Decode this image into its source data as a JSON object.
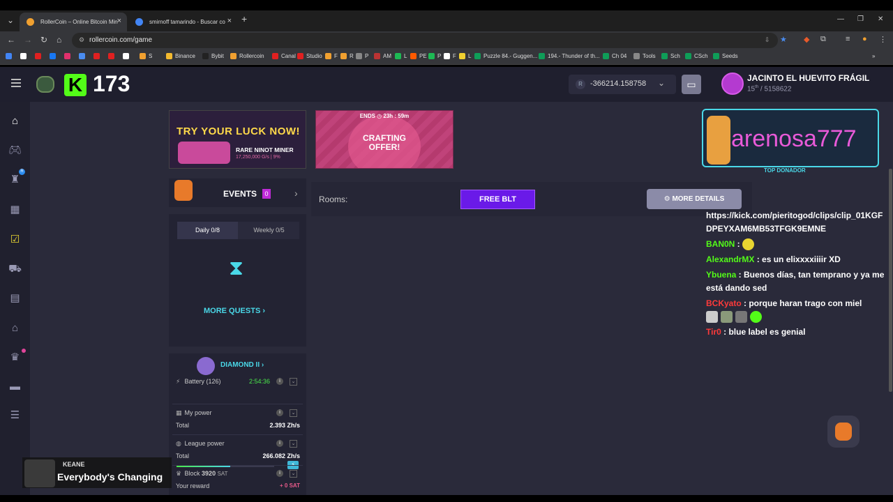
{
  "browser": {
    "tabs": [
      {
        "title": "RollerCoin – Online Bitcoin Min",
        "active": true,
        "color": "#f0a030"
      },
      {
        "title": "smirnoff tamarindo - Buscar co",
        "active": false,
        "color": "#4285f4"
      }
    ],
    "url": "rollercoin.com/game",
    "bookmarks": [
      {
        "label": "S",
        "color": "#f0a030"
      },
      {
        "label": "Binance",
        "color": "#f3ba2f"
      },
      {
        "label": "Bybit",
        "color": "#222"
      },
      {
        "label": "Rollercoin",
        "color": "#f0a030"
      },
      {
        "label": "Canal",
        "color": "#e02020"
      },
      {
        "label": "Studio",
        "color": "#e02020"
      },
      {
        "label": "F",
        "color": "#f0a030"
      },
      {
        "label": "R",
        "color": "#f0a030"
      },
      {
        "label": "P",
        "color": "#888"
      },
      {
        "label": "AM",
        "color": "#b33"
      },
      {
        "label": "L",
        "color": "#1db954"
      },
      {
        "label": "PE",
        "color": "#ff5a00"
      },
      {
        "label": "P",
        "color": "#1db954"
      },
      {
        "label": "F",
        "color": "#fff"
      },
      {
        "label": "L",
        "color": "#f0d030"
      },
      {
        "label": "Puzzle 84.- Guggen...",
        "color": "#0f9d58"
      },
      {
        "label": "194.- Thunder of th...",
        "color": "#0f9d58"
      },
      {
        "label": "Ch 04",
        "color": "#0f9d58"
      },
      {
        "label": "Tools",
        "color": "#888"
      },
      {
        "label": "Sch",
        "color": "#0f9d58"
      },
      {
        "label": "CSch",
        "color": "#0f9d58"
      },
      {
        "label": "Seeds",
        "color": "#0f9d58"
      }
    ]
  },
  "topbar": {
    "kick_count": "173",
    "balance": "-366214.158758",
    "balance_icon": "R",
    "user_name": "JACINTO EL HUEVITO FRÁGIL",
    "user_rank": "15",
    "user_rank_suffix": "th",
    "user_total": "/ 5158622"
  },
  "banners": {
    "luck_title": "TRY YOUR LUCK NOW!",
    "luck_sub": "RARE NINOT MINER",
    "luck_detail": "17,250,000 G/s | 9%",
    "ends_label": "ENDS",
    "ends_time": "23h : 59m",
    "crafting": "CRAFTING OFFER!"
  },
  "events": {
    "label": "EVENTS",
    "count": "0"
  },
  "quests": {
    "daily": "Daily 0/8",
    "weekly": "Weekly 0/5",
    "more": "MORE QUESTS"
  },
  "mining": {
    "league": "DIAMOND II",
    "battery_label": "Battery (126)",
    "battery_time": "2:54:36",
    "battery_level": 0.55,
    "my_power": "My power",
    "total_label": "Total",
    "my_total": "2.393 Zh/s",
    "league_power": "League power",
    "league_total": "266.082 Zh/s",
    "block_label": "Block",
    "block_value": "3920",
    "block_unit": "SAT",
    "reward_label": "Your reward",
    "reward_value": "+ 0 SAT"
  },
  "rooms": {
    "label": "Rooms:",
    "free_blt": "FREE BLT",
    "more_details": "MORE DETAILS"
  },
  "overlay": {
    "donor_name": "arenosa777",
    "donor_label": "TOP DONADOR",
    "chat": [
      {
        "user": "BANON",
        "text": "",
        "color": "#fff"
      },
      {
        "user": "",
        "text": "https://kick.com/pieritogod/clips/clip_01KGFDPEYXAM6MB53TFGK9EMNE",
        "color": "#fff"
      },
      {
        "user": "BAN0N",
        "text": " : ",
        "color": "#53fc18"
      },
      {
        "user": "AlexandrMX",
        "text": " : es un elixxxxiiiir XD",
        "color": "#53fc18"
      },
      {
        "user": "Ybuena",
        "text": " : Buenos días, tan temprano y ya me está dando sed",
        "color": "#53fc18"
      },
      {
        "user": "BCKyato",
        "text": " : porque haran trago con miel",
        "color": "#ff3a3a"
      },
      {
        "user": "Tir0",
        "text": " : blue label es genial",
        "color": "#ff3a3a"
      }
    ],
    "song_artist": "KEANE",
    "song_title": "Everybody's Changing"
  }
}
